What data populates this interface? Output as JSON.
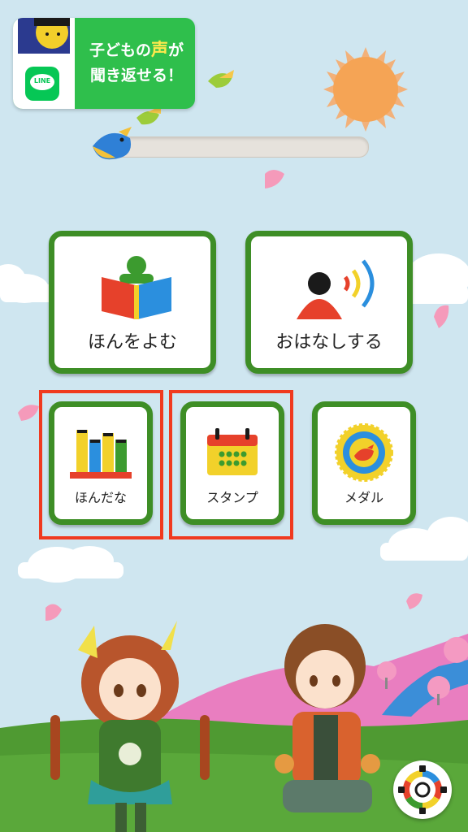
{
  "line_banner": {
    "logo_text": "LINE",
    "line1_prefix": "子どもの",
    "line1_highlight": "声",
    "line1_suffix": "が",
    "line2": "聞き返せる！"
  },
  "progress": {
    "fraction": 0.0
  },
  "menu": {
    "read_book": "ほんをよむ",
    "talk": "おはなしする",
    "bookshelf": "ほんだな",
    "stamp": "スタンプ",
    "medal": "メダル"
  },
  "colors": {
    "tile_border": "#3e8e26",
    "highlight": "#f03a1f",
    "line_green": "#2fbf4c",
    "sun": "#f5a455"
  },
  "icons": {
    "read_book": "book-reader-icon",
    "talk": "speaking-person-icon",
    "bookshelf": "bookshelf-icon",
    "stamp": "calendar-icon",
    "medal": "medal-icon",
    "settings": "gear-icon"
  }
}
